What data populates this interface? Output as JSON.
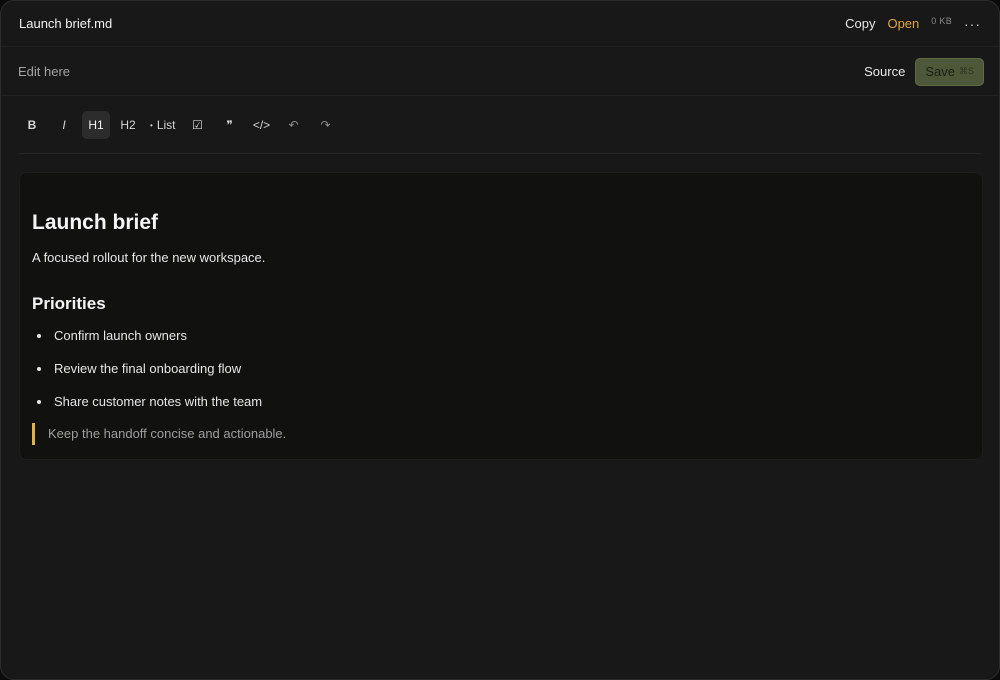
{
  "titlebar": {
    "file_name": "Launch brief.md",
    "copy_label": "Copy",
    "open_label": "Open",
    "size": "0 KB",
    "more_label": "···"
  },
  "editbar": {
    "hint": "Edit here",
    "source_label": "Source",
    "save_label": "Save",
    "save_shortcut": "⌘S"
  },
  "toolbar": {
    "bold": "B",
    "italic": "I",
    "h1": "H1",
    "h2": "H2",
    "list_bullet": "•",
    "list": "List",
    "task": "☑",
    "quote": "❞",
    "code": "</>",
    "undo": "↶",
    "redo": "↷",
    "active_item": "H1"
  },
  "document": {
    "title": "Launch brief",
    "lead": "A focused rollout for the new workspace.",
    "section_heading": "Priorities",
    "items": [
      "Confirm launch owners",
      "Review the final onboarding flow",
      "Share customer notes with the team"
    ],
    "quote": "Keep the handoff concise and actionable."
  },
  "colors": {
    "accent_open": "#e3a43d",
    "quote_bar": "#e3b24a",
    "save_bg": "#4e5838"
  }
}
